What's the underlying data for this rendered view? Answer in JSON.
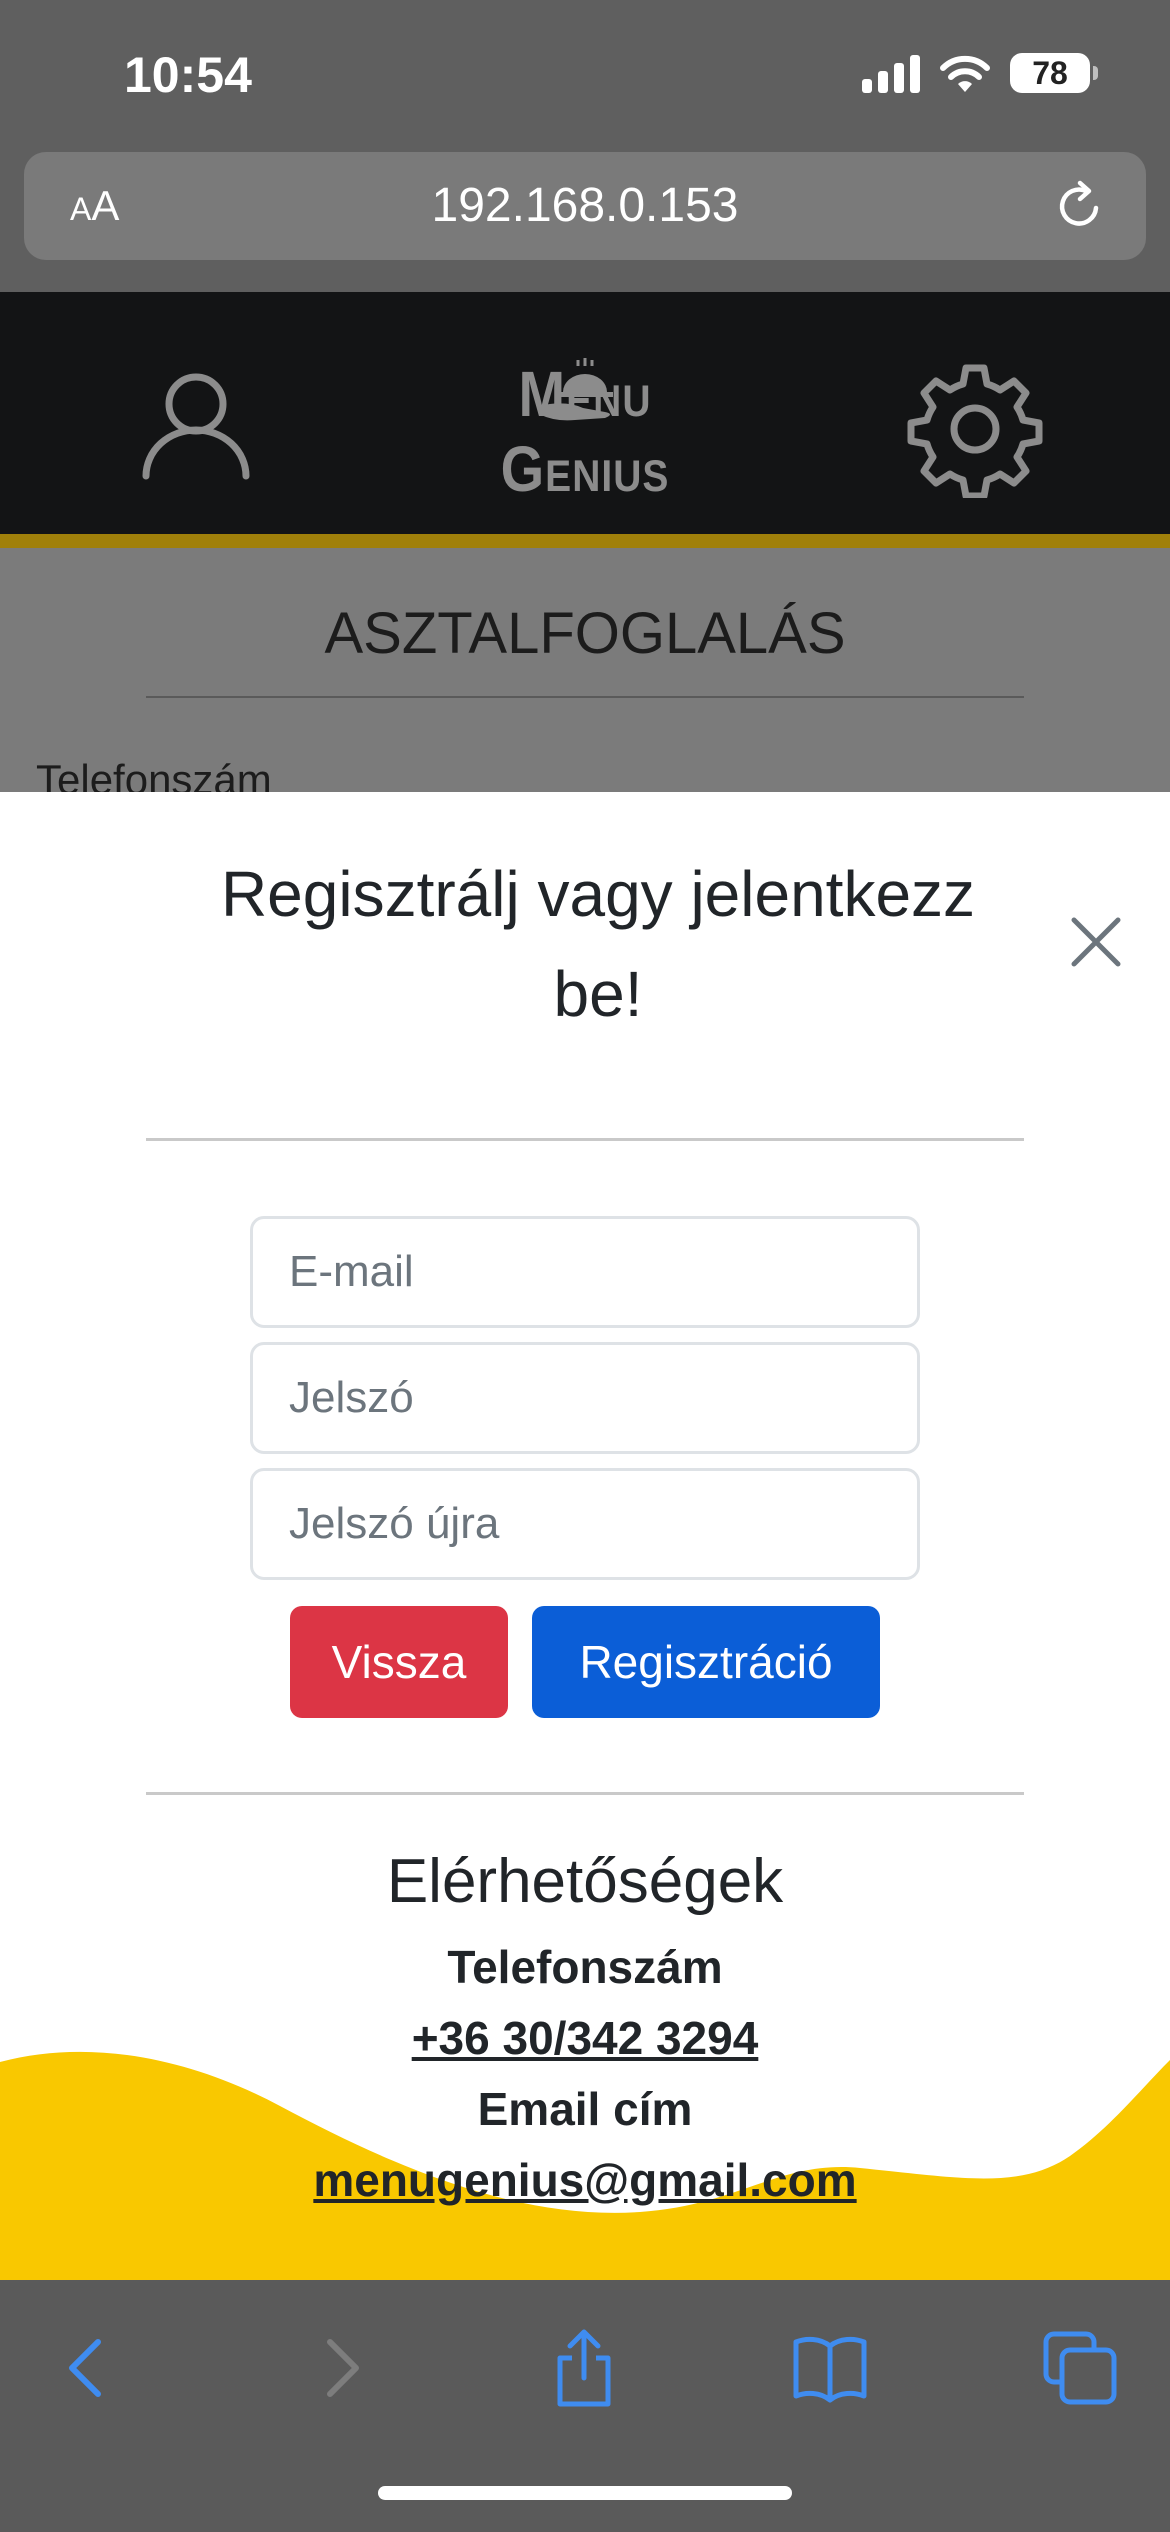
{
  "status_bar": {
    "time": "10:54",
    "battery": "78"
  },
  "browser": {
    "text_size_label_small": "A",
    "text_size_label_large": "A",
    "url": "192.168.0.153"
  },
  "header": {
    "logo_text": "Menu Genius"
  },
  "underlying_page": {
    "title": "ASZTALFOGLALÁS",
    "field_label": "Telefonszám"
  },
  "modal": {
    "title": "Regisztrálj vagy jelentkezz be!",
    "email_placeholder": "E-mail",
    "password_placeholder": "Jelszó",
    "password_repeat_placeholder": "Jelszó újra",
    "back_label": "Vissza",
    "register_label": "Regisztráció"
  },
  "contacts": {
    "title": "Elérhetőségek",
    "phone_label": "Telefonszám",
    "phone": "+36 30/342 3294",
    "email_label": "Email cím",
    "email": "menugenius@gmail.com"
  },
  "colors": {
    "danger": "#dc3545",
    "primary": "#0b5ed7",
    "accent_yellow": "#f9c800",
    "header_bg": "#131415",
    "browser_blue": "#3f8cf0"
  },
  "icons": [
    "user-icon",
    "gear-icon",
    "close-icon",
    "reload-icon",
    "back-icon",
    "forward-icon",
    "share-icon",
    "bookmarks-icon",
    "tabs-icon",
    "wifi-icon",
    "signal-icon"
  ]
}
